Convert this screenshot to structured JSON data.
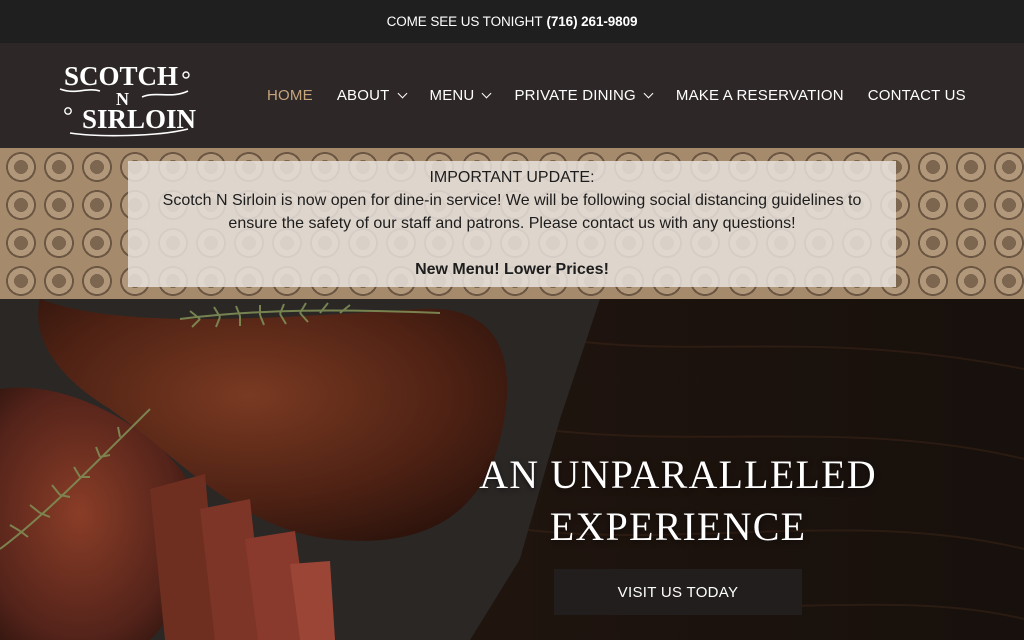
{
  "top_bar": {
    "prefix": "COME SEE US TONIGHT",
    "phone": "(716) 261-9809"
  },
  "brand": {
    "logo_line1": "SCOTCH",
    "logo_line2": "N",
    "logo_line3": "SIRLOIN",
    "logo_icon": "brand-logo"
  },
  "nav": {
    "items": [
      {
        "label": "HOME",
        "active": true,
        "has_dropdown": false
      },
      {
        "label": "ABOUT",
        "active": false,
        "has_dropdown": true
      },
      {
        "label": "MENU",
        "active": false,
        "has_dropdown": true
      },
      {
        "label": "PRIVATE DINING",
        "active": false,
        "has_dropdown": true
      },
      {
        "label": "MAKE A RESERVATION",
        "active": false,
        "has_dropdown": false
      },
      {
        "label": "CONTACT US",
        "active": false,
        "has_dropdown": false
      }
    ]
  },
  "notice": {
    "title": "IMPORTANT UPDATE:",
    "body": "Scotch N Sirloin is now open for dine-in service! We will be following social distancing guidelines to ensure the safety of our staff and patrons. Please contact us with any questions!",
    "promo": "New Menu! Lower Prices!"
  },
  "hero": {
    "heading_line1": "AN UNPARALLELED",
    "heading_line2": "EXPERIENCE",
    "cta_label": "VISIT US TODAY",
    "image_icon": "steak-on-board-photo"
  },
  "colors": {
    "top_bar_bg": "#1f1f1f",
    "nav_bg": "#2d2728",
    "nav_active": "#c6a57d",
    "pattern_bg": "#a58a6c",
    "cta_bg": "#221e1e"
  }
}
